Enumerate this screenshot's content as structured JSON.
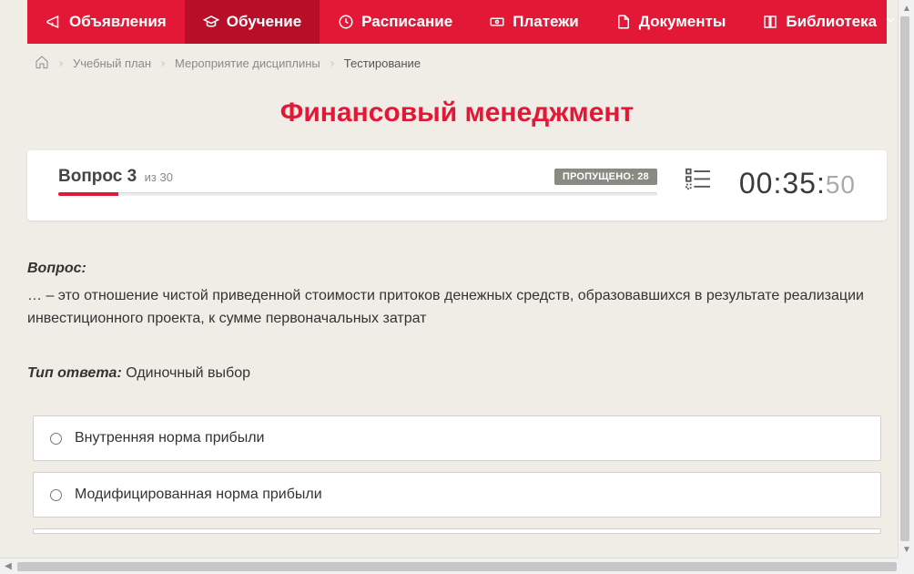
{
  "nav": {
    "items": [
      {
        "id": "announcements",
        "label": "Объявления",
        "active": false
      },
      {
        "id": "learning",
        "label": "Обучение",
        "active": true
      },
      {
        "id": "schedule",
        "label": "Расписание",
        "active": false
      },
      {
        "id": "payments",
        "label": "Платежи",
        "active": false
      },
      {
        "id": "documents",
        "label": "Документы",
        "active": false
      },
      {
        "id": "library",
        "label": "Библиотека",
        "active": false,
        "has_dropdown": true
      }
    ]
  },
  "breadcrumb": {
    "items": [
      {
        "label": "Учебный план",
        "link": true
      },
      {
        "label": "Мероприятие дисциплины",
        "link": true
      },
      {
        "label": "Тестирование",
        "link": false
      }
    ]
  },
  "title": "Финансовый менеджмент",
  "question_header": {
    "prefix": "Вопрос",
    "number": "3",
    "of_word": "из",
    "total": "30",
    "skipped_label": "ПРОПУЩЕНО:",
    "skipped_count": "28"
  },
  "timer": {
    "mm": "00",
    "ss": "35",
    "ms": "50"
  },
  "question": {
    "label": "Вопрос:",
    "text": "… – это отношение чистой приведенной стоимости притоков денежных средств, образовавшихся в результате реализации инвестиционного проекта, к сумме первоначальных затрат"
  },
  "answer_type": {
    "label": "Тип ответа:",
    "value": "Одиночный выбор"
  },
  "answers": [
    {
      "text": "Внутренняя норма прибыли"
    },
    {
      "text": "Модифицированная норма прибыли"
    }
  ]
}
